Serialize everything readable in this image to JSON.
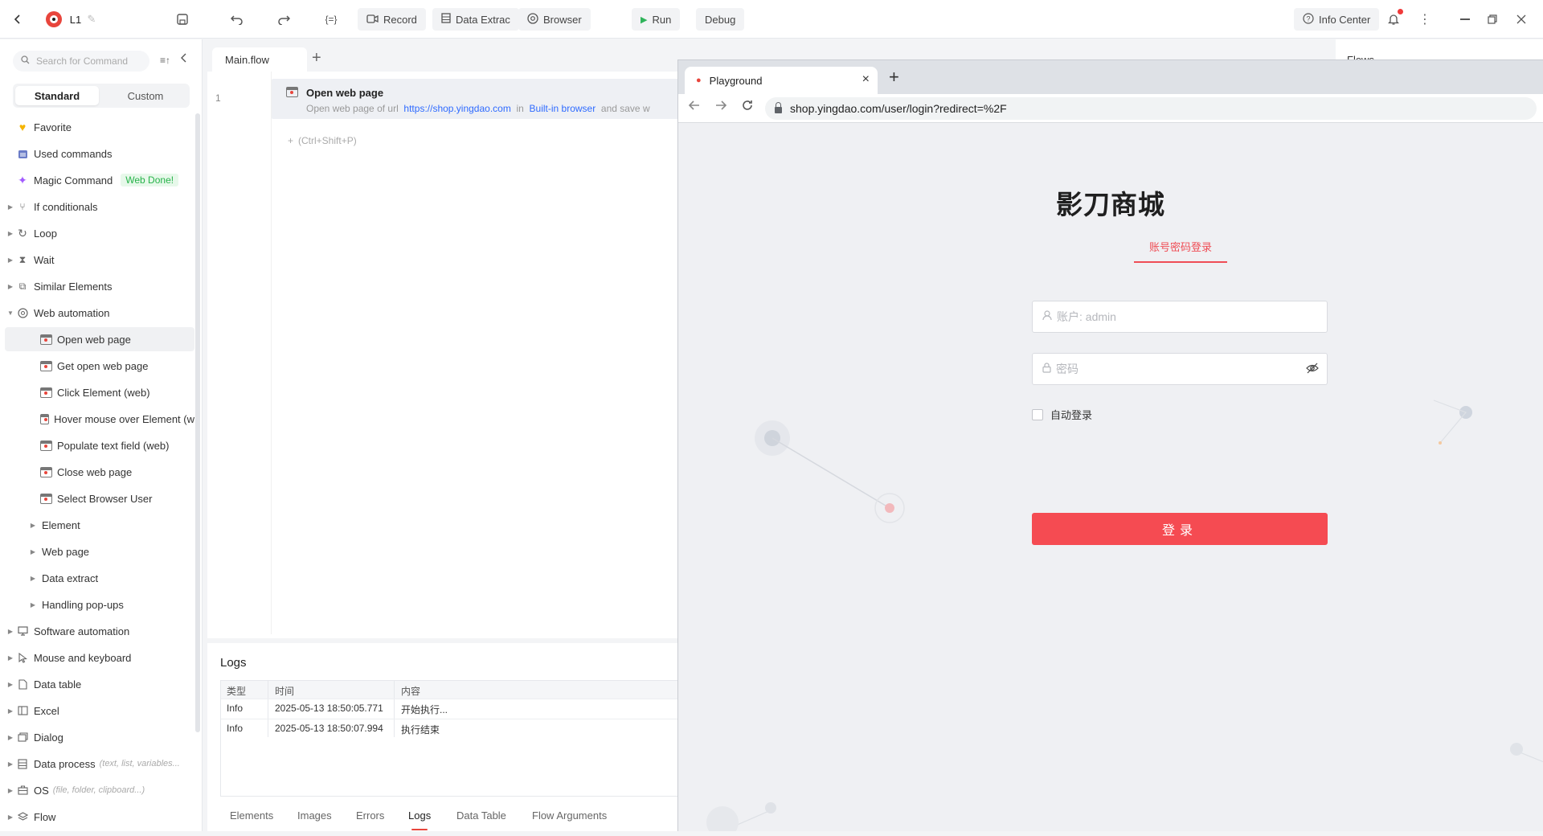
{
  "app": {
    "project_name": "L1",
    "toolbar": {
      "record": "Record",
      "data_extract": "Data Extrac",
      "browser": "Browser",
      "run": "Run",
      "debug": "Debug",
      "info_center": "Info Center"
    }
  },
  "sidebar": {
    "search_placeholder": "Search for Command",
    "tabs": {
      "standard": "Standard",
      "custom": "Custom"
    },
    "items": {
      "favorite": "Favorite",
      "used_commands": "Used commands",
      "magic_command": "Magic Command",
      "magic_badge": "Web Done!",
      "if_conditionals": "If conditionals",
      "loop": "Loop",
      "wait": "Wait",
      "similar_elements": "Similar Elements",
      "web_automation": "Web automation",
      "open_web_page": "Open web page",
      "get_open_web_page": "Get open web page",
      "click_element_web": "Click Element (web)",
      "hover_mouse": "Hover mouse over Element (w",
      "populate_text_field": "Populate text field (web)",
      "close_web_page": "Close web page",
      "select_browser_user": "Select Browser User",
      "element": "Element",
      "web_page": "Web page",
      "data_extract": "Data extract",
      "handling_popups": "Handling pop-ups",
      "software_automation": "Software automation",
      "mouse_keyboard": "Mouse and keyboard",
      "data_table": "Data table",
      "excel": "Excel",
      "dialog": "Dialog",
      "data_process": "Data process",
      "data_process_hint": "(text, list, variables...",
      "os": "OS",
      "os_hint": "(file, folder, clipboard...)",
      "flow": "Flow"
    }
  },
  "editor": {
    "tab": "Main.flow",
    "line_number": "1",
    "step": {
      "title": "Open web page",
      "desc_prefix": "Open web page of url",
      "url": "https://shop.yingdao.com",
      "in": "in",
      "browser": "Built-in browser",
      "desc_suffix": "and save w"
    },
    "add_hint": "(Ctrl+Shift+P)"
  },
  "logs": {
    "title": "Logs",
    "columns": [
      "类型",
      "时间",
      "内容"
    ],
    "rows": [
      {
        "type": "Info",
        "time": "2025-05-13 18:50:05.771",
        "content": "开始执行..."
      },
      {
        "type": "Info",
        "time": "2025-05-13 18:50:07.994",
        "content": "执行结束"
      }
    ],
    "bottom_tabs": [
      "Elements",
      "Images",
      "Errors",
      "Logs",
      "Data Table",
      "Flow Arguments"
    ]
  },
  "right_panel": {
    "title": "Flows"
  },
  "browser": {
    "tab_title": "Playground",
    "url": "shop.yingdao.com/user/login?redirect=%2F",
    "page": {
      "title": "影刀商城",
      "login_tab": "账号密码登录",
      "account_placeholder": "账户: admin",
      "password_placeholder": "密码",
      "auto_login": "自动登录",
      "login_button": "登录"
    }
  },
  "colors": {
    "accent_red": "#f54b52",
    "link_blue": "#2f6bff",
    "run_green": "#2fb35a"
  }
}
